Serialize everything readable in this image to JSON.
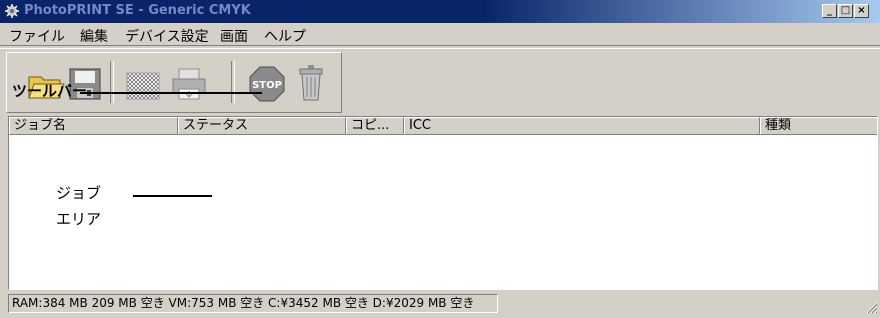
{
  "window": {
    "title": "PhotoPRINT SE - Generic CMYK",
    "minimize_glyph": "_",
    "maximize_glyph": "□",
    "close_glyph": "×"
  },
  "menu": {
    "items": [
      "ファイル",
      "編集",
      "デバイス設定",
      "画面",
      "ヘルプ"
    ]
  },
  "toolbar": {
    "annotation_label": "ツールバー",
    "buttons": [
      "open-folder-icon",
      "save-icon",
      "rip-icon",
      "print-icon",
      "stop-icon",
      "trash-icon"
    ]
  },
  "job_list": {
    "columns": [
      "ジョブ名",
      "ステータス",
      "コピ...",
      "ICC",
      "種類"
    ],
    "annotation_label_line1": "ジョブ",
    "annotation_label_line2": "エリア"
  },
  "status_bar": {
    "text": "RAM:384 MB 209 MB 空き VM:753 MB 空き C:¥3452 MB 空き D:¥2029 MB 空き"
  },
  "colors": {
    "title_active": "#0a246a",
    "title_text": "#7a86c8",
    "face": "#d4d0c8"
  }
}
